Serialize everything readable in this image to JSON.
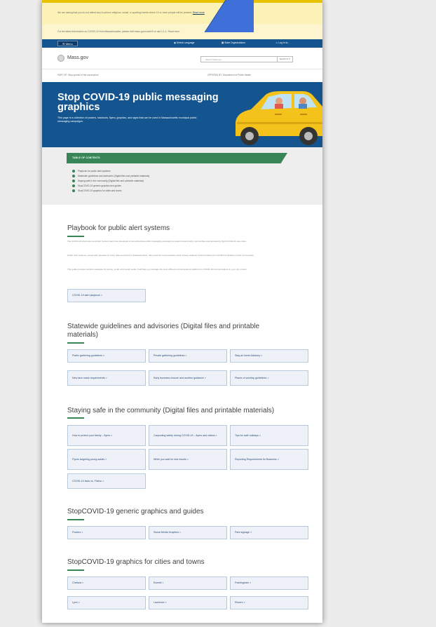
{
  "alerts": {
    "alert1_text": "We are asking that you do not attend any in-person religious, social, or sporting events where 10 or more people will be present.",
    "alert1_link": "Read more",
    "alert2_text": "For the latest information on COVID-19 from Massachusetts, please visit mass.gov/covid19 or call 2-1-1.",
    "alert2_link": "Read more"
  },
  "utilbar": {
    "menu": "Menu",
    "language": "Select Language",
    "state_orgs": "State Organizations",
    "login": "Log in to..."
  },
  "header": {
    "logo_text": "Mass.gov",
    "search_placeholder": "Search Mass.gov",
    "search_button": "SEARCH"
  },
  "breadcrumbs": {
    "left": "PART OF: Stop spread of the coronavirus",
    "right": "OFFERED BY: Department of Public Health"
  },
  "hero": {
    "title": "Stop COVID-19 public messaging graphics",
    "subtitle": "This page is a collection of posters, handouts, flyers, graphics, and signs that can be used in Massachusetts municipal public messaging campaigns."
  },
  "toc": {
    "heading": "TABLE OF CONTENTS",
    "items": [
      "Playbook for public alert systems",
      "Statewide guidelines and advisories (Digital files and printable materials)",
      "Staying safe in the community (Digital files and printable materials)",
      "StopCOVID-19 generic graphics and guides",
      "StopCOVID-19 graphics for cities and towns"
    ]
  },
  "sections": {
    "playbook": {
      "title": "Playbook for public alert systems",
      "paras": [
        "The COVID-19 Information and Alert System team has developed a comprehensive public messaging campaign to support local priority communities and persistently high COVID-19 case rates.",
        "Public Alert systems, owned and operated by many cities and towns in Massachusetts, offer powerful communication tools to keep residents informed about the COVID-19 situation in their communities.",
        "This guide provides sample messages for texting, email, and social media. It will help you leverage the most efficient communications platform for COVID-19 communications in your city or town."
      ],
      "button": "COVID-19 alert playbook >"
    },
    "statewide": {
      "title": "Statewide guidelines and advisories (Digital files and printable materials)",
      "links": [
        "Public gathering guidelines >",
        "Private gathering guidelines >",
        "Stay-at-home Advisory >",
        "New face mask requirements >",
        "Early business closure and another guidance >",
        "Places of worship guidelines >"
      ]
    },
    "community": {
      "title": "Staying safe in the community (Digital files and printable materials)",
      "links": [
        "How to protect your family – flyers >",
        "Carpooling safety during COVID-19 – flyers and videos >",
        "Tips for safe holidays >",
        "Flyers targeting young adults >",
        "While you wait for test results >",
        "Reporting Requirements for Business >",
        "COVID-19 facts vs. Fiction >"
      ]
    },
    "generic": {
      "title": "StopCOVID-19 generic graphics and guides",
      "links": [
        "Posters >",
        "Social Media Graphics >",
        "Park signage >"
      ]
    },
    "cities": {
      "title": "StopCOVID-19 graphics for cities and towns",
      "links": [
        "Chelsea >",
        "Everett >",
        "Framingham >",
        "Lynn >",
        "Lawrence >",
        "Revere >"
      ]
    }
  },
  "colors": {
    "brand_blue": "#14558f",
    "toc_green": "#388557",
    "alert_yellow": "#fdf2b6",
    "car_yellow": "#f3c21b",
    "pointer_arrow": "#3f6fd8"
  }
}
